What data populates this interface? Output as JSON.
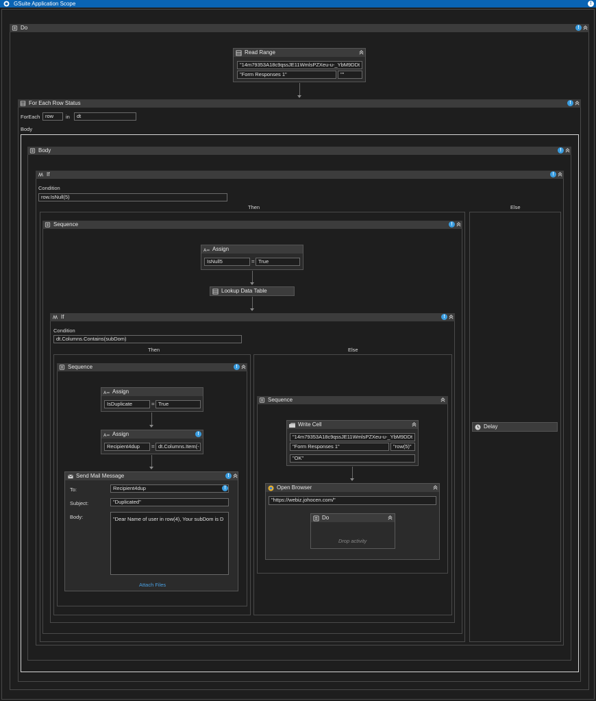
{
  "window": {
    "title": "GSuite Application Scope"
  },
  "do_outer": {
    "label": "Do"
  },
  "read_range": {
    "label": "Read Range",
    "spreadsheet": "\"14m79353A18c9qssJE11WmlsPZXeu-u-_YbM9DDt",
    "sheet": "\"Form Responses 1\"",
    "range": "\"\""
  },
  "for_each": {
    "label": "For Each Row Status",
    "foreach_label": "ForEach",
    "item": "row",
    "in_label": "in",
    "collection": "dt",
    "body_label": "Body"
  },
  "body": {
    "label": "Body"
  },
  "if_outer": {
    "label": "If",
    "condition_label": "Condition",
    "condition": "row.IsNull(5)",
    "then_label": "Then",
    "else_label": "Else"
  },
  "seq_main": {
    "label": "Sequence"
  },
  "assign1": {
    "label": "Assign",
    "to": "IsNull5",
    "value": "True"
  },
  "lookup": {
    "label": "Lookup Data Table"
  },
  "if_inner": {
    "label": "If",
    "condition_label": "Condition",
    "condition": "dt.Columns.Contains(subDom)",
    "then_label": "Then",
    "else_label": "Else"
  },
  "seq_then": {
    "label": "Sequence"
  },
  "assign2": {
    "label": "Assign",
    "to": "IsDuplicate",
    "value": "True"
  },
  "assign3": {
    "label": "Assign",
    "to": "Recipient4dup",
    "value": "dt.Columns.Item(-"
  },
  "send_mail": {
    "label": "Send Mail Message",
    "to_label": "To:",
    "to": "Recipient4dup",
    "subject_label": "Subject:",
    "subject": "\"Duplicated\"",
    "body_label": "Body:",
    "body": "\"Dear Name of user in row(4), Your subDom is D",
    "attach": "Attach Files"
  },
  "seq_else": {
    "label": "Sequence"
  },
  "write_cell": {
    "label": "Write Cell",
    "spreadsheet": "\"14m79353A18c9qssJE11WmlsPZXeu-u-_YbM9DDt",
    "sheet": "\"Form Responses 1\"",
    "cell": "\"row(5)\"",
    "value": "\"OK\""
  },
  "open_browser": {
    "label": "Open Browser",
    "url": "\"https://webiz.johocen.com/\""
  },
  "do_inner": {
    "label": "Do",
    "placeholder": "Drop activity"
  },
  "delay": {
    "label": "Delay"
  },
  "colors": {
    "titlebar": "#0a64b4",
    "info": "#3a9de0",
    "canvas": "#1e1e1e",
    "header": "#3c3c3c"
  }
}
